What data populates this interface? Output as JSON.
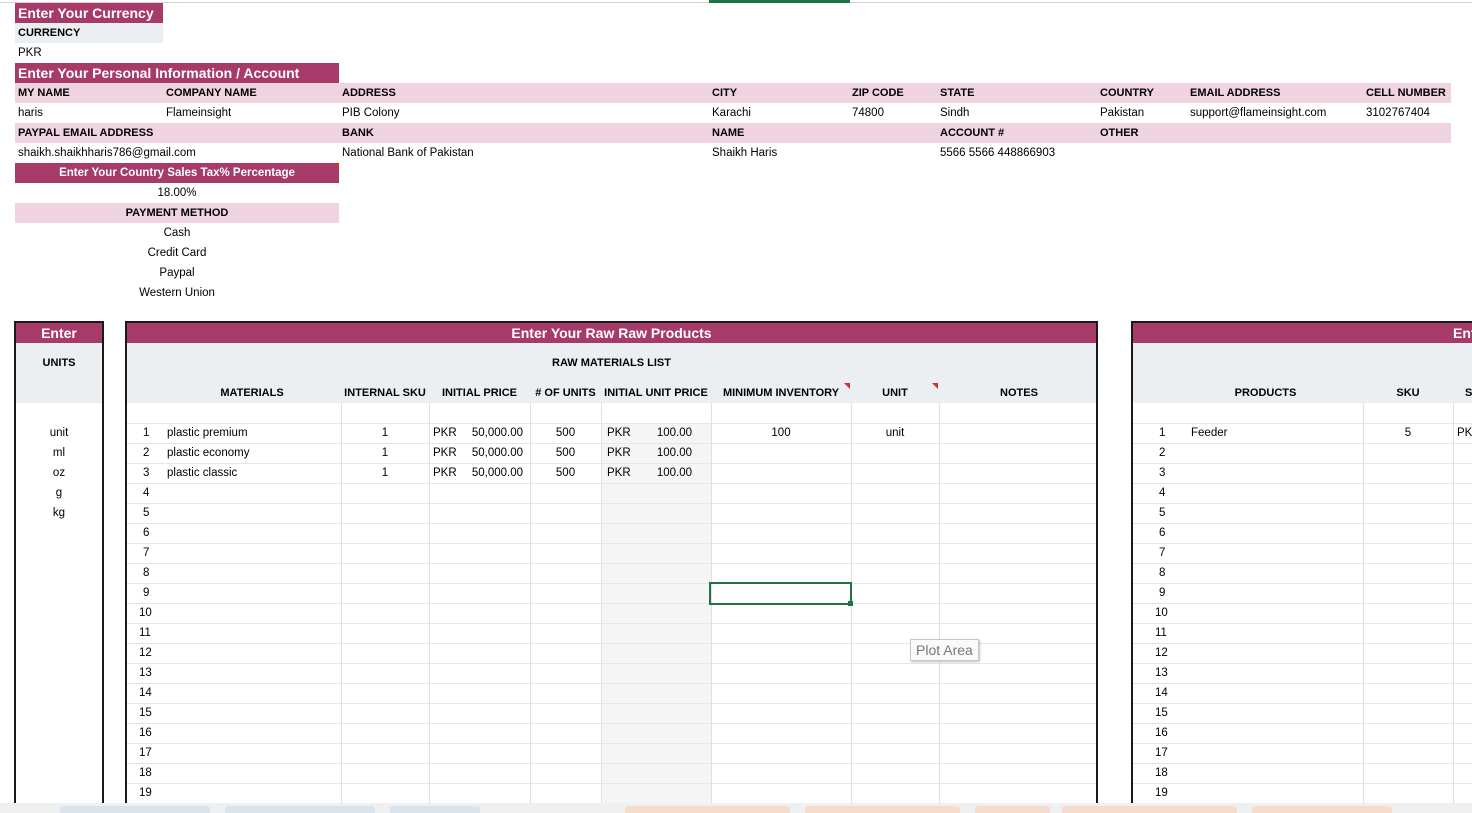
{
  "currency_section": {
    "title": "Enter Your Currency",
    "label": "CURRENCY",
    "value": "PKR"
  },
  "personal_section": {
    "title": "Enter Your Personal Information / Account",
    "row1_labels": [
      "MY NAME",
      "COMPANY NAME",
      "ADDRESS",
      "CITY",
      "ZIP CODE",
      "STATE",
      "COUNTRY",
      "EMAIL ADDRESS",
      "CELL NUMBER"
    ],
    "row1_values": [
      "haris",
      "Flameinsight",
      "PIB Colony",
      "Karachi",
      "74800",
      "Sindh",
      "Pakistan",
      "support@flameinsight.com",
      "3102767404"
    ],
    "row2_labels": [
      "PAYPAL EMAIL ADDRESS",
      "BANK",
      "NAME",
      "ACCOUNT #",
      "OTHER"
    ],
    "row2_values": [
      "shaikh.shaikhharis786@gmail.com",
      "National Bank of Pakistan",
      "Shaikh Haris",
      "5566 5566 448866903",
      ""
    ]
  },
  "tax_section": {
    "title": "Enter Your Country Sales Tax% Percentage",
    "value": "18.00%"
  },
  "payment_section": {
    "title": "PAYMENT METHOD",
    "methods": [
      "Cash",
      "Credit Card",
      "Paypal",
      "Western Union"
    ]
  },
  "units_table": {
    "title": "Enter",
    "header": "UNITS",
    "units": [
      "unit",
      "ml",
      "oz",
      "g",
      "kg"
    ]
  },
  "raw_table": {
    "title": "Enter Your Raw Raw Products",
    "subtitle": "RAW MATERIALS LIST",
    "columns": [
      "MATERIALS",
      "INTERNAL SKU",
      "INITIAL PRICE",
      "# OF UNITS",
      "INITIAL UNIT PRICE",
      "MINIMUM INVENTORY",
      "UNIT",
      "NOTES"
    ],
    "rows": [
      {
        "num": "1",
        "material": "plastic premium",
        "sku": "1",
        "price_cur": "PKR",
        "price": "50,000.00",
        "units": "500",
        "unit_cur": "PKR",
        "unit_price": "100.00",
        "min_inv": "100",
        "unit": "unit"
      },
      {
        "num": "2",
        "material": "plastic economy",
        "sku": "1",
        "price_cur": "PKR",
        "price": "50,000.00",
        "units": "500",
        "unit_cur": "PKR",
        "unit_price": "100.00",
        "min_inv": "",
        "unit": ""
      },
      {
        "num": "3",
        "material": "plastic classic",
        "sku": "1",
        "price_cur": "PKR",
        "price": "50,000.00",
        "units": "500",
        "unit_cur": "PKR",
        "unit_price": "100.00",
        "min_inv": "",
        "unit": ""
      }
    ],
    "row_numbers": [
      "1",
      "2",
      "3",
      "4",
      "5",
      "6",
      "7",
      "8",
      "9",
      "10",
      "11",
      "12",
      "13",
      "14",
      "15",
      "16",
      "17",
      "18",
      "19"
    ]
  },
  "products_table": {
    "title": "Ent",
    "columns": [
      "PRODUCTS",
      "SKU",
      "SE"
    ],
    "rows": [
      {
        "num": "1",
        "product": "Feeder",
        "sku": "5",
        "cur": "PKI"
      }
    ],
    "row_numbers": [
      "1",
      "2",
      "3",
      "4",
      "5",
      "6",
      "7",
      "8",
      "9",
      "10",
      "11",
      "12",
      "13",
      "14",
      "15",
      "16",
      "17",
      "18",
      "19"
    ]
  },
  "tooltip": {
    "text": "Plot Area"
  },
  "colors": {
    "header": "#a63a68",
    "pink": "#f0d3e0",
    "gray": "#eceff1",
    "selection": "#217346"
  }
}
